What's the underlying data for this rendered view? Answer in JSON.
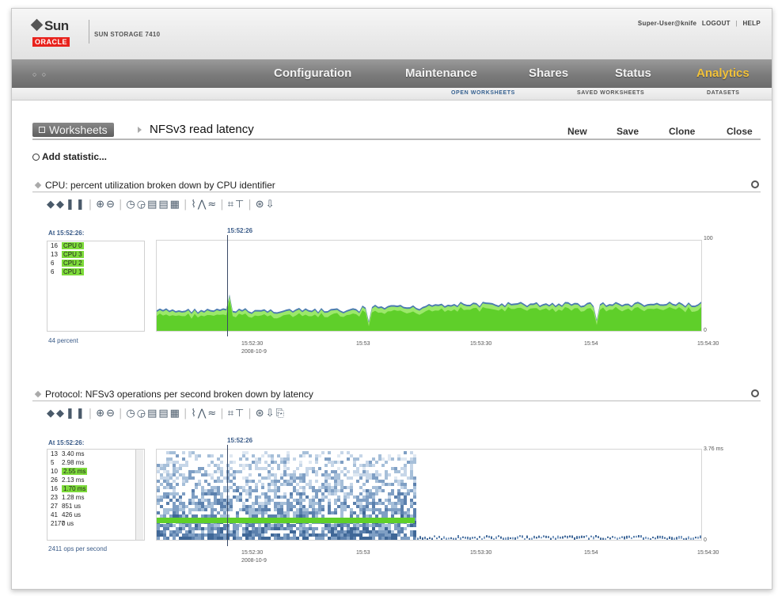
{
  "brand": {
    "sun": "Sun",
    "oracle": "ORACLE",
    "product": "SUN STORAGE 7410"
  },
  "user": {
    "name": "Super-User@knife",
    "logout": "LOGOUT",
    "help": "HELP"
  },
  "nav": {
    "dots": "○ ○",
    "items": [
      "Configuration",
      "Maintenance",
      "Shares",
      "Status",
      "Analytics"
    ],
    "active": "Analytics"
  },
  "subnav": {
    "open": "OPEN WORKSHEETS",
    "saved": "SAVED WORKSHEETS",
    "datasets": "DATASETS"
  },
  "worksheet": {
    "button": "Worksheets",
    "title": "NFSv3 read latency",
    "actions": {
      "new": "New",
      "save": "Save",
      "clone": "Clone",
      "close": "Close"
    }
  },
  "add_statistic": "Add statistic...",
  "stat1": {
    "title": "CPU: percent utilization broken down by CPU identifier",
    "at": "At 15:52:26:",
    "cursor": "15:52:26",
    "rows": [
      {
        "count": "16",
        "label": "CPU 0"
      },
      {
        "count": "13",
        "label": "CPU 3"
      },
      {
        "count": "6",
        "label": "CPU 2"
      },
      {
        "count": "6",
        "label": "CPU 1"
      }
    ],
    "footer": "44 percent",
    "ymax": "100",
    "ymin": "0",
    "xticks": [
      "15:52:30",
      "15:53",
      "15:53:30",
      "15:54",
      "15:54:30"
    ],
    "date": "2008-10-9"
  },
  "stat2": {
    "title": "Protocol: NFSv3 operations per second broken down by latency",
    "at": "At 15:52:26:",
    "cursor": "15:52:26",
    "rows": [
      {
        "count": "13",
        "label": "3.40 ms",
        "hl": false
      },
      {
        "count": "5",
        "label": "2.98 ms",
        "hl": false
      },
      {
        "count": "10",
        "label": "2.55 ms",
        "hl": true
      },
      {
        "count": "26",
        "label": "2.13 ms",
        "hl": false
      },
      {
        "count": "16",
        "label": "1.70 ms",
        "hl": true
      },
      {
        "count": "23",
        "label": "1.28 ms",
        "hl": false
      },
      {
        "count": "27",
        "label": "851 us",
        "hl": false
      },
      {
        "count": "41",
        "label": "426 us",
        "hl": false
      },
      {
        "count": "2177",
        "label": "0 us",
        "hl": false
      }
    ],
    "footer": "2411 ops per second",
    "ymax": "3.76 ms",
    "ymin": "0",
    "xticks": [
      "15:52:30",
      "15:53",
      "15:53:30",
      "15:54",
      "15:54:30"
    ],
    "date": "2008-10-9"
  },
  "colors": {
    "accent": "#f2c23a",
    "highlight": "#7ddb3a",
    "series_green": "#5fcf2a",
    "series_blue": "#4a7ab0"
  }
}
